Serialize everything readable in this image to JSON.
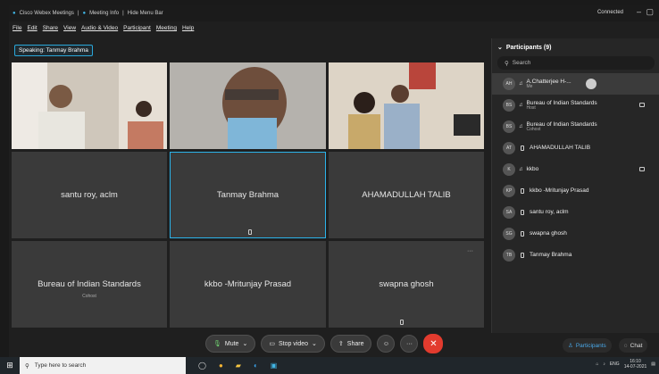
{
  "window": {
    "title": "Cisco Webex Meetings",
    "meeting_info": "Meeting Info",
    "hide_menu": "Hide Menu Bar",
    "status": "Connected"
  },
  "menu": [
    "File",
    "Edit",
    "Share",
    "View",
    "Audio & Video",
    "Participant",
    "Meeting",
    "Help"
  ],
  "speaking": "Speaking: Tanmay Brahma",
  "tiles": [
    {
      "name": "santu roy, aclm",
      "sub": ""
    },
    {
      "name": "Tanmay Brahma",
      "sub": ""
    },
    {
      "name": "AHAMADULLAH TALIB",
      "sub": ""
    },
    {
      "name": "Bureau of Indian Standards",
      "sub": "Cohost"
    },
    {
      "name": "kkbo -Mritunjay Prasad",
      "sub": ""
    },
    {
      "name": "swapna ghosh",
      "sub": ""
    }
  ],
  "participants_panel": {
    "title": "Participants (9)",
    "search_placeholder": "Search",
    "items": [
      {
        "initials": "AH",
        "name": "A.Chatterjee H-...",
        "role": "Me"
      },
      {
        "initials": "BS",
        "name": "Bureau of Indian Standards",
        "role": "Host"
      },
      {
        "initials": "BS",
        "name": "Bureau of Indian Standards",
        "role": "Cohost"
      },
      {
        "initials": "AT",
        "name": "AHAMADULLAH TALIB",
        "role": ""
      },
      {
        "initials": "K",
        "name": "kkbo",
        "role": ""
      },
      {
        "initials": "KP",
        "name": "kkbo -Mritunjay Prasad",
        "role": ""
      },
      {
        "initials": "SA",
        "name": "santu roy, aclm",
        "role": ""
      },
      {
        "initials": "SG",
        "name": "swapna ghosh",
        "role": ""
      },
      {
        "initials": "TB",
        "name": "Tanmay Brahma",
        "role": ""
      }
    ]
  },
  "controls": {
    "mute": "Mute",
    "stop_video": "Stop video",
    "share": "Share"
  },
  "panel_buttons": {
    "participants": "Participants",
    "chat": "Chat"
  },
  "taskbar": {
    "search_placeholder": "Type here to search",
    "lang": "ENG",
    "time": "16:10",
    "date": "14-07-2021"
  },
  "colors": {
    "accent": "#2bb3ea",
    "end": "#e23b2e"
  }
}
